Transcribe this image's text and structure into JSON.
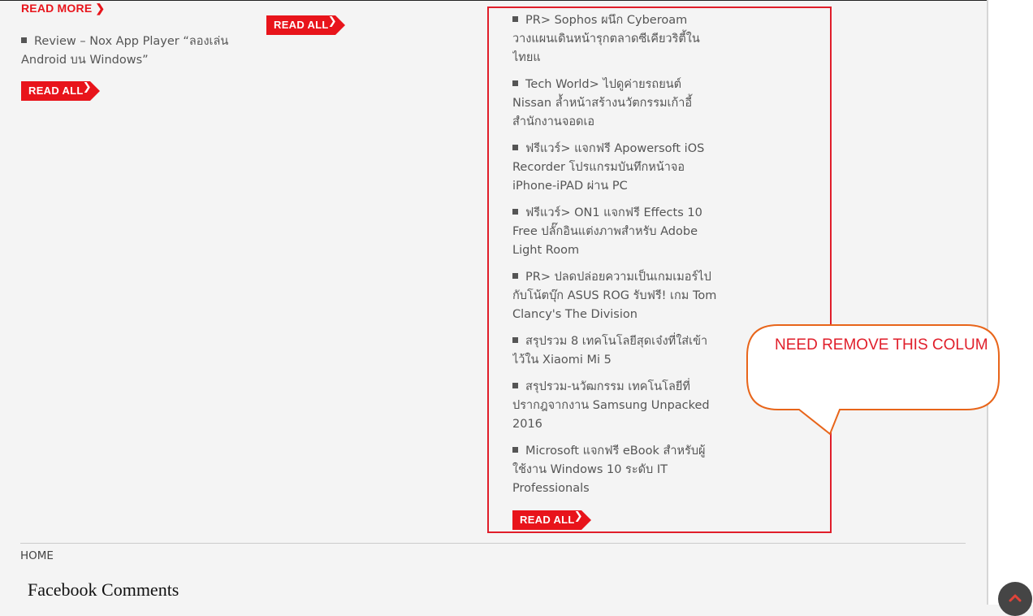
{
  "left": {
    "read_more_label": "READ MORE",
    "post_title": "Review – Nox App Player “ลองเล่น Android บน Windows”",
    "read_all_label": "READ ALL"
  },
  "middle": {
    "read_all_label": "READ ALL"
  },
  "sidebar": {
    "posts": [
      "PR> Sophos ผนึก Cyberoam วางแผนเดินหน้ารุกตลาดซีเคียวริตี้ในไทยแ",
      "Tech World> ไปดูค่ายรถยนต์ Nissan ล้ำหน้าสร้างนวัตกรรมเก้าอี้สำนักงานจอดเอ",
      "ฟรีแวร์> แจกฟรี Apowersoft iOS Recorder โปรแกรมบันทึกหน้าจอ iPhone-iPAD ผ่าน PC",
      "ฟรีแวร์> ON1 แจกฟรี Effects 10 Free ปลั๊กอินแต่งภาพสำหรับ Adobe Light Room",
      "PR> ปลดปล่อยความเป็นเกมเมอร์ไปกับโน้ตบุ๊ก ASUS ROG รับฟรี! เกม Tom Clancy's The Division",
      "สรุปรวม 8 เทคโนโลยีสุดเจ๋งที่ใส่เข้าไว้ใน Xiaomi Mi 5",
      "สรุปรวม-นวัฒกรรม เทคโนโลยีที่ปรากฎจากงาน Samsung Unpacked 2016",
      "Microsoft แจกฟรี eBook สำหรับผู้ใช้งาน Windows 10 ระดับ IT Professionals"
    ],
    "read_all_label": "READ ALL"
  },
  "annotation": {
    "callout_text": "NEED REMOVE THIS COLUM"
  },
  "footer": {
    "home_label": "HOME",
    "comments_title": "Facebook Comments"
  },
  "icons": {
    "chevron": "chevron-right-icon",
    "scroll_top": "chevron-up-icon"
  },
  "colors": {
    "accent": "#e8141b",
    "box_border": "#e01e2a",
    "callout_border": "#e8651a"
  }
}
